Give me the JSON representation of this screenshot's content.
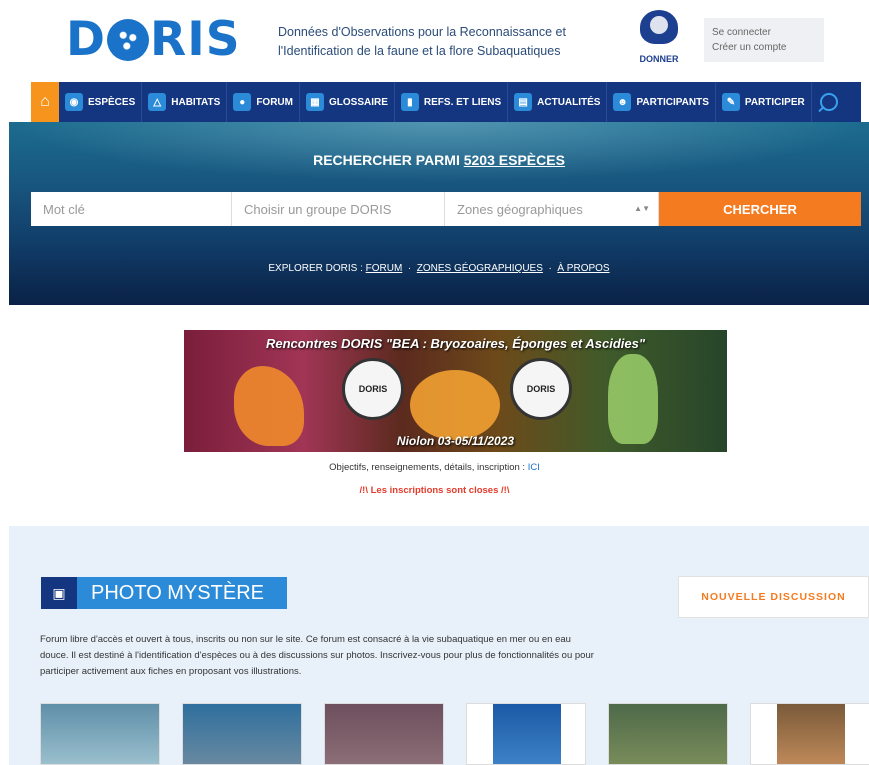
{
  "header": {
    "logo_text": "D RIS",
    "tagline": "Données d'Observations pour la Reconnaissance et l'Identification de la faune et la flore Subaquatiques",
    "donate_label": "DONNER",
    "login_label": "Se connecter",
    "register_label": "Créer un compte"
  },
  "nav": {
    "items": [
      {
        "label": "ESPÈCES",
        "icon": "fish-icon"
      },
      {
        "label": "HABITATS",
        "icon": "habitat-icon"
      },
      {
        "label": "FORUM",
        "icon": "chat-icon"
      },
      {
        "label": "GLOSSAIRE",
        "icon": "glossary-icon"
      },
      {
        "label": "REFS. ET LIENS",
        "icon": "book-icon"
      },
      {
        "label": "ACTUALITÉS",
        "icon": "news-icon"
      },
      {
        "label": "PARTICIPANTS",
        "icon": "people-icon"
      },
      {
        "label": "PARTICIPER",
        "icon": "pencil-icon"
      }
    ]
  },
  "hero": {
    "title_prefix": "RECHERCHER PARMI",
    "title_count": "5203 ESPÈCES",
    "keyword_placeholder": "Mot clé",
    "group_placeholder": "Choisir un groupe DORIS",
    "zones_placeholder": "Zones géographiques",
    "search_button": "CHERCHER",
    "explore_label": "EXPLORER DORIS :",
    "explore_forum": "FORUM",
    "explore_zones": "ZONES GÉOGRAPHIQUES",
    "explore_about": "À PROPOS"
  },
  "banner": {
    "title": "Rencontres DORIS \"BEA : Bryozoaires, Éponges et Ascidies\"",
    "seal_label": "DORIS",
    "date": "Niolon 03-05/11/2023",
    "info_text": "Objectifs, renseignements, détails, inscription :",
    "info_link": "ICI",
    "closed_text": "/!\\ Les inscriptions sont closes /!\\"
  },
  "forum": {
    "title": "PHOTO MYSTÈRE",
    "new_discussion": "NOUVELLE DISCUSSION",
    "description": "Forum libre d'accès et ouvert à tous, inscrits ou non sur le site. Ce forum est consacré à la vie subaquatique en mer ou en eau douce. Il est destiné à l'identification d'espèces ou à des discussions sur photos. Inscrivez-vous pour plus de fonctionnalités ou pour participer activement aux fiches en proposant vos illustrations."
  },
  "colors": {
    "brand_blue": "#1a73c9",
    "nav_bg": "#14357f",
    "accent_orange": "#f47b20",
    "alert_red": "#e33b2a"
  }
}
